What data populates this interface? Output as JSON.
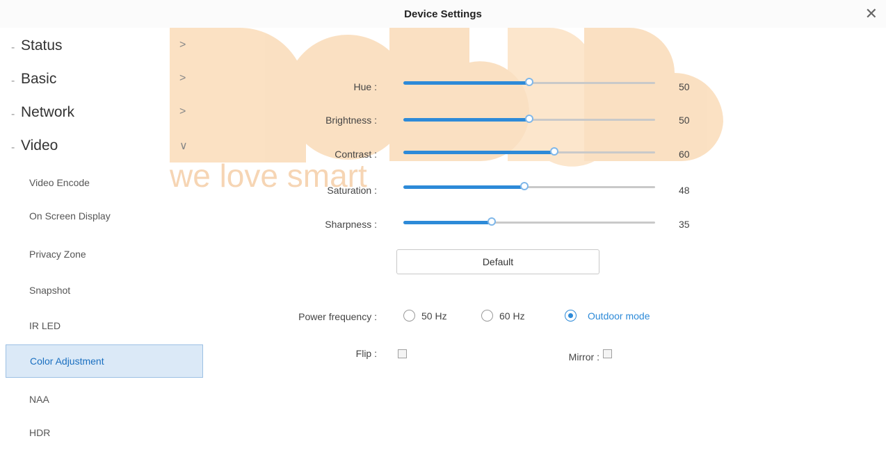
{
  "window": {
    "title": "Device Settings",
    "close_icon": "close-icon"
  },
  "watermark": {
    "text": "we love smart"
  },
  "sidebar": {
    "top_items": [
      {
        "label": "Status",
        "bullet": "-",
        "chevron": ">"
      },
      {
        "label": "Basic",
        "bullet": "-",
        "chevron": ">"
      },
      {
        "label": "Network",
        "bullet": "-",
        "chevron": ">"
      },
      {
        "label": "Video",
        "bullet": "-",
        "chevron": "∨"
      }
    ],
    "video_items": [
      {
        "label": "Video Encode"
      },
      {
        "label": "On Screen Display"
      },
      {
        "label": "Privacy Zone"
      },
      {
        "label": "Snapshot"
      },
      {
        "label": "IR LED"
      },
      {
        "label": "Color Adjustment",
        "active": true
      },
      {
        "label": "NAA"
      },
      {
        "label": "HDR"
      }
    ]
  },
  "color_adjustment": {
    "sliders": [
      {
        "label": "Hue :",
        "value": "50"
      },
      {
        "label": "Brightness :",
        "value": "50"
      },
      {
        "label": "Contrast :",
        "value": "60"
      },
      {
        "label": "Saturation :",
        "value": "48"
      },
      {
        "label": "Sharpness :",
        "value": "35"
      }
    ],
    "slider_max": 100,
    "default_button": "Default",
    "power_frequency": {
      "label": "Power frequency :",
      "options": [
        "50 Hz",
        "60 Hz",
        "Outdoor mode"
      ],
      "selected": "Outdoor mode"
    },
    "flip": {
      "label": "Flip :",
      "checked": false
    },
    "mirror": {
      "label": "Mirror :",
      "checked": false
    }
  },
  "colors": {
    "accent": "#2d8ad8",
    "watermark": "#f5b77a",
    "active_bg": "#dbe9f7"
  }
}
